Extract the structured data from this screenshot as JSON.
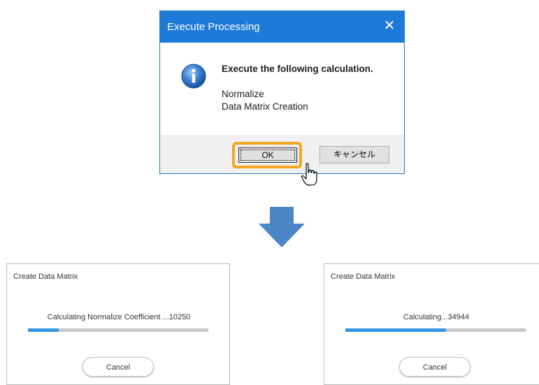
{
  "execute_dialog": {
    "title": "Execute Processing",
    "close_glyph": "✕",
    "icon": "info-icon",
    "message": "Execute the following calculation.",
    "items": [
      "Normalize",
      "Data Matrix Creation"
    ],
    "ok_label": "OK",
    "cancel_label": "キャンセル",
    "titlebar_color": "#1c7ad8",
    "highlight_color": "#f5a623"
  },
  "arrow": {
    "icon": "down-arrow-icon",
    "color": "#4a86c8"
  },
  "progress_left": {
    "title": "Create Data Matrix",
    "status": "Calculating Normalize Coefficient ...10250",
    "progress_percent": 17,
    "cancel_label": "Cancel"
  },
  "progress_right": {
    "title": "Create Data Matrix",
    "status": "Calculating...34944",
    "progress_percent": 56,
    "cancel_label": "Cancel"
  }
}
